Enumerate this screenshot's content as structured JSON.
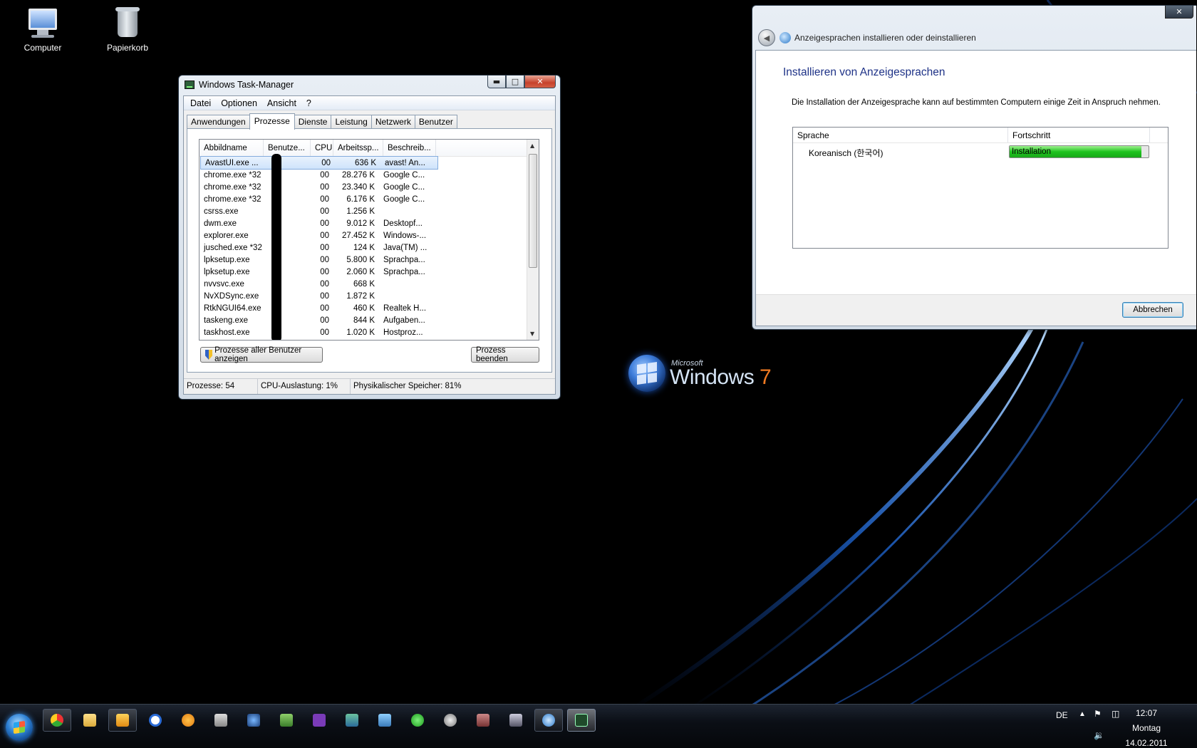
{
  "desktop": {
    "icons": [
      {
        "label": "Computer"
      },
      {
        "label": "Papierkorb"
      }
    ],
    "logo": {
      "ms": "Microsoft",
      "win": "Windows",
      "ver": "7"
    }
  },
  "taskmgr": {
    "title": "Windows Task-Manager",
    "menu": [
      "Datei",
      "Optionen",
      "Ansicht",
      "?"
    ],
    "tabs": [
      "Anwendungen",
      "Prozesse",
      "Dienste",
      "Leistung",
      "Netzwerk",
      "Benutzer"
    ],
    "active_tab": "Prozesse",
    "columns": [
      "Abbildname",
      "Benutze...",
      "CPU",
      "Arbeitssp...",
      "Beschreib..."
    ],
    "rows": [
      {
        "name": "AvastUI.exe ...",
        "cpu": "00",
        "mem": "636 K",
        "desc": "avast! An..."
      },
      {
        "name": "chrome.exe *32",
        "cpu": "00",
        "mem": "28.276 K",
        "desc": "Google C..."
      },
      {
        "name": "chrome.exe *32",
        "cpu": "00",
        "mem": "23.340 K",
        "desc": "Google C..."
      },
      {
        "name": "chrome.exe *32",
        "cpu": "00",
        "mem": "6.176 K",
        "desc": "Google C..."
      },
      {
        "name": "csrss.exe",
        "cpu": "00",
        "mem": "1.256 K",
        "desc": ""
      },
      {
        "name": "dwm.exe",
        "cpu": "00",
        "mem": "9.012 K",
        "desc": "Desktopf..."
      },
      {
        "name": "explorer.exe",
        "cpu": "00",
        "mem": "27.452 K",
        "desc": "Windows-..."
      },
      {
        "name": "jusched.exe *32",
        "cpu": "00",
        "mem": "124 K",
        "desc": "Java(TM) ..."
      },
      {
        "name": "lpksetup.exe",
        "cpu": "00",
        "mem": "5.800 K",
        "desc": "Sprachpa..."
      },
      {
        "name": "lpksetup.exe",
        "cpu": "00",
        "mem": "2.060 K",
        "desc": "Sprachpa..."
      },
      {
        "name": "nvvsvc.exe",
        "cpu": "00",
        "mem": "668 K",
        "desc": ""
      },
      {
        "name": "NvXDSync.exe",
        "cpu": "00",
        "mem": "1.872 K",
        "desc": ""
      },
      {
        "name": "RtkNGUI64.exe",
        "cpu": "00",
        "mem": "460 K",
        "desc": "Realtek H..."
      },
      {
        "name": "taskeng.exe",
        "cpu": "00",
        "mem": "844 K",
        "desc": "Aufgaben..."
      },
      {
        "name": "taskhost.exe",
        "cpu": "00",
        "mem": "1.020 K",
        "desc": "Hostproz..."
      }
    ],
    "show_all_btn": "Prozesse aller Benutzer anzeigen",
    "end_btn": "Prozess beenden",
    "status": {
      "procs": "Prozesse: 54",
      "cpu": "CPU-Auslastung: 1%",
      "mem": "Physikalischer Speicher: 81%"
    }
  },
  "langwin": {
    "nav_title": "Anzeigesprachen installieren oder deinstallieren",
    "heading": "Installieren von Anzeigesprachen",
    "desc": "Die Installation der Anzeigesprache kann auf bestimmten Computern einige Zeit in Anspruch nehmen.",
    "col_lang": "Sprache",
    "col_progress": "Fortschritt",
    "row": {
      "lang": "Koreanisch (한국어)",
      "status": "Installation",
      "progress": 0.95
    },
    "cancel_btn": "Abbrechen"
  },
  "taskbar": {
    "lang": "DE",
    "time": "12:07",
    "day": "Montag",
    "date": "14.02.2011"
  }
}
